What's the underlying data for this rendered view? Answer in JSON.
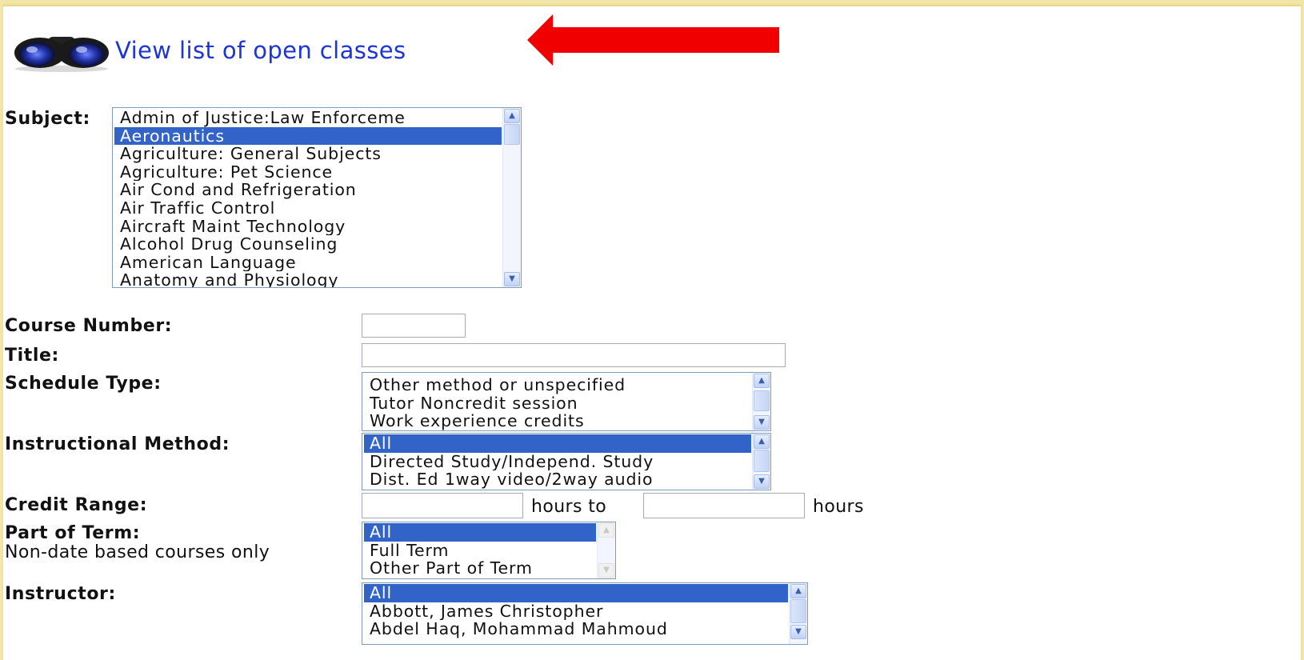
{
  "header": {
    "link_text": "View list of open classes",
    "link_icon": "binoculars-icon",
    "arrow_color": "#ff0000"
  },
  "form": {
    "subject": {
      "label": "Subject:",
      "options": [
        "Admin of Justice:Law Enforceme",
        "Aeronautics",
        "Agriculture: General Subjects",
        "Agriculture: Pet Science",
        "Air Cond and Refrigeration",
        "Air Traffic Control",
        "Aircraft Maint Technology",
        "Alcohol Drug Counseling",
        "American Language",
        "Anatomy and Physiology"
      ],
      "selected": "Aeronautics"
    },
    "course_number": {
      "label": "Course Number:",
      "value": ""
    },
    "title": {
      "label": "Title:",
      "value": ""
    },
    "schedule_type": {
      "label": "Schedule Type:",
      "options": [
        "Other method or unspecified",
        "Tutor Noncredit session",
        "Work experience credits"
      ]
    },
    "instructional_method": {
      "label": "Instructional Method:",
      "options": [
        "All",
        "Directed Study/Independ. Study",
        "Dist. Ed 1way video/2way audio"
      ],
      "selected": "All"
    },
    "credit_range": {
      "label": "Credit Range:",
      "from_value": "",
      "to_value": "",
      "middle_text": "hours to",
      "end_text": "hours"
    },
    "part_of_term": {
      "label": "Part of Term:",
      "sublabel": "Non-date based courses only",
      "options": [
        "All",
        "Full Term",
        "Other Part of Term"
      ],
      "selected": "All"
    },
    "instructor": {
      "label": "Instructor:",
      "options": [
        "All",
        "Abbott, James Christopher",
        "Abdel Haq, Mohammad Mahmoud"
      ],
      "selected": "All"
    }
  },
  "colors": {
    "link": "#1d35d8",
    "selection": "#3163c9",
    "page_border": "#f2e6a6"
  }
}
